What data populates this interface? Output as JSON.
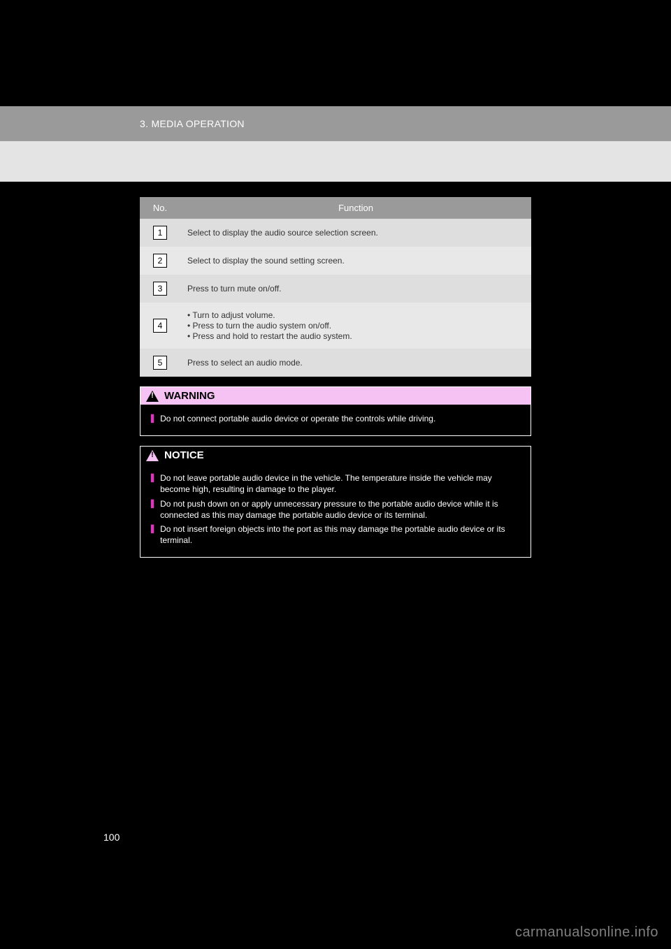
{
  "section_header": "3. MEDIA OPERATION",
  "table": {
    "headers": {
      "no": "No.",
      "function": "Function"
    },
    "rows": [
      {
        "no": "1",
        "type": "text",
        "text": "Select to display the audio source selection screen."
      },
      {
        "no": "2",
        "type": "text",
        "text": "Select to display the sound setting screen."
      },
      {
        "no": "3",
        "type": "text",
        "text": "Press to turn mute on/off."
      },
      {
        "no": "4",
        "type": "bullets",
        "items": [
          "Turn to adjust volume.",
          "Press to turn the audio system on/off.",
          "Press and hold to restart the audio system."
        ]
      },
      {
        "no": "5",
        "type": "text",
        "text": "Press to select an audio mode."
      }
    ]
  },
  "warning": {
    "label": "WARNING",
    "items": [
      "Do not connect portable audio device or operate the controls while driving."
    ]
  },
  "notice": {
    "label": "NOTICE",
    "items": [
      "Do not leave portable audio device in the vehicle. The temperature inside the vehicle may become high, resulting in damage to the player.",
      "Do not push down on or apply unnecessary pressure to the portable audio device while it is connected as this may damage the portable audio device or its terminal.",
      "Do not insert foreign objects into the port as this may damage the portable audio device or its terminal."
    ]
  },
  "page_number": "100",
  "watermark": "carmanualsonline.info"
}
